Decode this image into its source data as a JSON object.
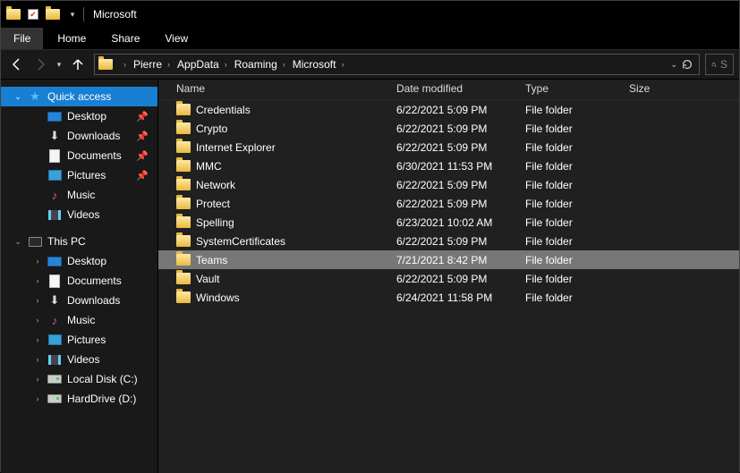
{
  "window": {
    "title": "Microsoft"
  },
  "ribbon": {
    "file": "File",
    "tabs": [
      "Home",
      "Share",
      "View"
    ]
  },
  "breadcrumb": [
    "Pierre",
    "AppData",
    "Roaming",
    "Microsoft"
  ],
  "search": {
    "placeholder": "S"
  },
  "sidebar": {
    "quick_access": "Quick access",
    "quick_items": [
      {
        "label": "Desktop",
        "icon": "desktop",
        "pinned": true
      },
      {
        "label": "Downloads",
        "icon": "downloads",
        "pinned": true
      },
      {
        "label": "Documents",
        "icon": "doc",
        "pinned": true
      },
      {
        "label": "Pictures",
        "icon": "pic",
        "pinned": true
      },
      {
        "label": "Music",
        "icon": "music",
        "pinned": false
      },
      {
        "label": "Videos",
        "icon": "video",
        "pinned": false
      }
    ],
    "this_pc": "This PC",
    "pc_items": [
      {
        "label": "Desktop",
        "icon": "desktop"
      },
      {
        "label": "Documents",
        "icon": "doc"
      },
      {
        "label": "Downloads",
        "icon": "downloads"
      },
      {
        "label": "Music",
        "icon": "music"
      },
      {
        "label": "Pictures",
        "icon": "pic"
      },
      {
        "label": "Videos",
        "icon": "video"
      },
      {
        "label": "Local Disk (C:)",
        "icon": "drive"
      },
      {
        "label": "HardDrive (D:)",
        "icon": "drive"
      }
    ]
  },
  "columns": {
    "name": "Name",
    "date": "Date modified",
    "type": "Type",
    "size": "Size",
    "sort": "name_asc"
  },
  "rows": [
    {
      "name": "Credentials",
      "date": "6/22/2021 5:09 PM",
      "type": "File folder",
      "selected": false
    },
    {
      "name": "Crypto",
      "date": "6/22/2021 5:09 PM",
      "type": "File folder",
      "selected": false
    },
    {
      "name": "Internet Explorer",
      "date": "6/22/2021 5:09 PM",
      "type": "File folder",
      "selected": false
    },
    {
      "name": "MMC",
      "date": "6/30/2021 11:53 PM",
      "type": "File folder",
      "selected": false
    },
    {
      "name": "Network",
      "date": "6/22/2021 5:09 PM",
      "type": "File folder",
      "selected": false
    },
    {
      "name": "Protect",
      "date": "6/22/2021 5:09 PM",
      "type": "File folder",
      "selected": false
    },
    {
      "name": "Spelling",
      "date": "6/23/2021 10:02 AM",
      "type": "File folder",
      "selected": false
    },
    {
      "name": "SystemCertificates",
      "date": "6/22/2021 5:09 PM",
      "type": "File folder",
      "selected": false
    },
    {
      "name": "Teams",
      "date": "7/21/2021 8:42 PM",
      "type": "File folder",
      "selected": true
    },
    {
      "name": "Vault",
      "date": "6/22/2021 5:09 PM",
      "type": "File folder",
      "selected": false
    },
    {
      "name": "Windows",
      "date": "6/24/2021 11:58 PM",
      "type": "File folder",
      "selected": false
    }
  ]
}
